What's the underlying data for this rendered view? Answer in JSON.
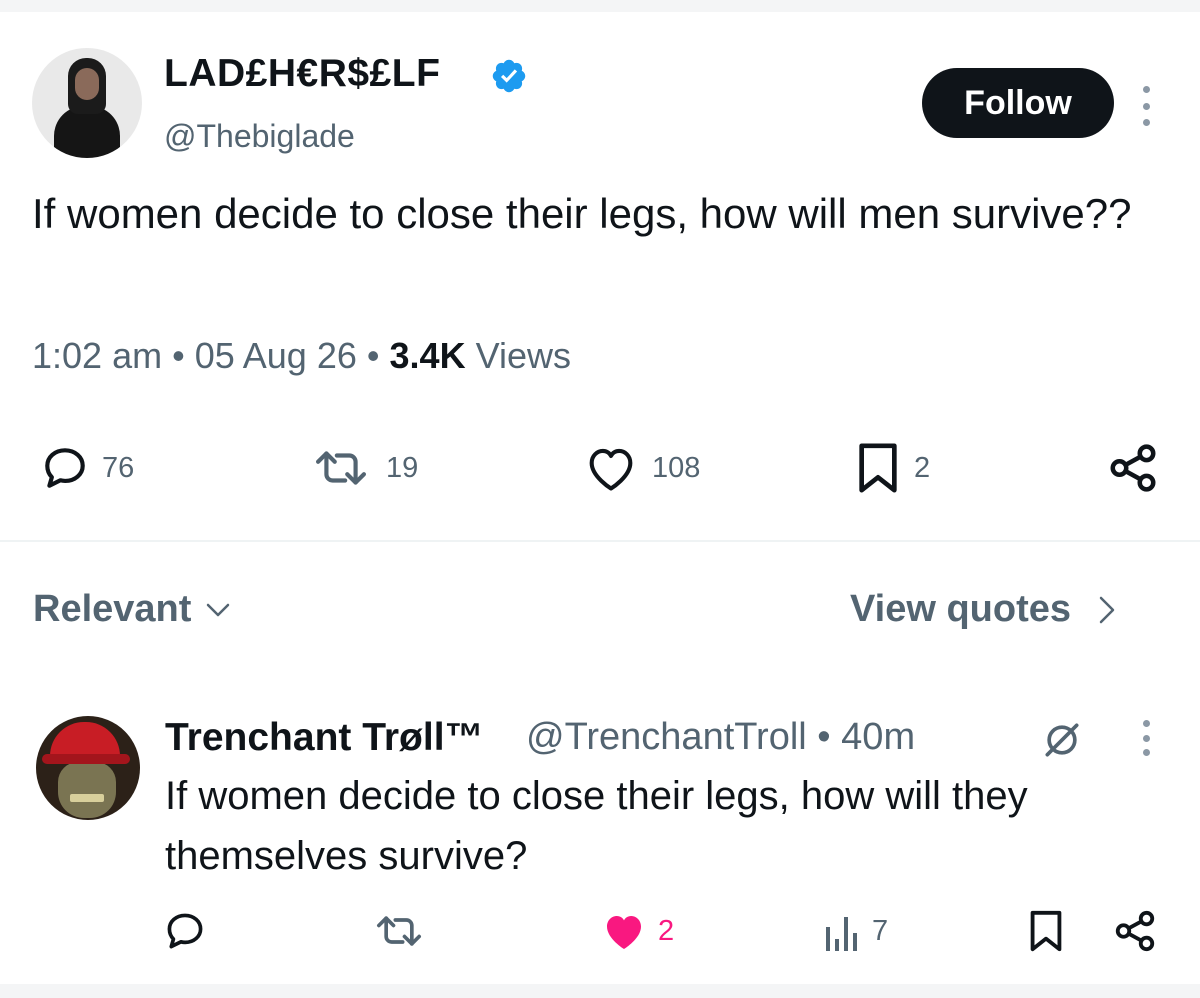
{
  "tweet": {
    "display_name": "LAD£H€R$£LF",
    "handle": "@Thebiglade",
    "follow_label": "Follow",
    "text": "If women decide to close their legs, how will men survive??",
    "time": "1:02 am",
    "date": "05 Aug 26",
    "views_count": "3.4K",
    "views_label": "Views",
    "separator": "•",
    "actions": {
      "replies": "76",
      "reposts": "19",
      "likes": "108",
      "bookmarks": "2"
    },
    "icons": {
      "verified": "verified-badge-icon",
      "more": "more-vertical-icon",
      "reply": "comment-icon",
      "repost": "repost-icon",
      "like": "heart-icon",
      "bookmark": "bookmark-icon",
      "share": "share-icon"
    }
  },
  "filters": {
    "relevant_label": "Relevant",
    "view_quotes_label": "View quotes"
  },
  "reply": {
    "display_name": "Trenchant Trøll™",
    "handle": "@TrenchantTroll",
    "time": "40m",
    "separator": "•",
    "text": "If women decide to close their legs, how will they themselves survive?",
    "actions": {
      "likes": "2",
      "views": "7"
    },
    "liked": true
  },
  "colors": {
    "text": "#0f1419",
    "secondary": "#536471",
    "verified": "#1d9bf0",
    "like_active": "#f91880",
    "button_bg": "#0f1419"
  }
}
